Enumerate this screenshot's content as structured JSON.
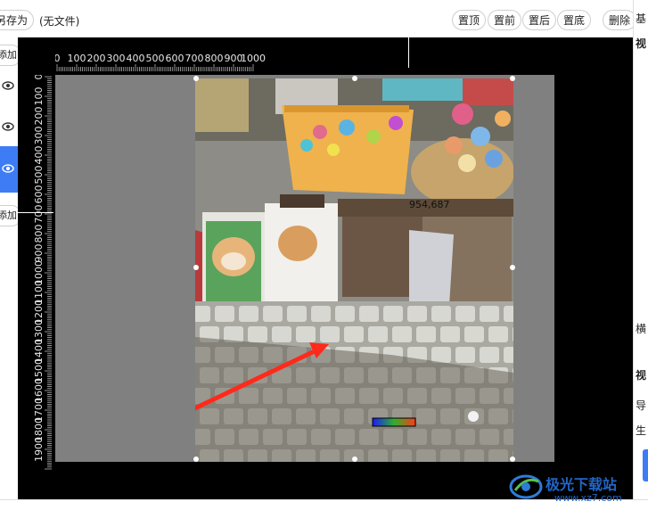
{
  "toolbar": {
    "save_as": "另存为",
    "file_name": "(无文件)",
    "to_top": "置顶",
    "forward": "置前",
    "backward": "置后",
    "to_bottom": "置底",
    "delete": "删除"
  },
  "sidebar": {
    "add_top": "添加",
    "add_bottom": "添加"
  },
  "rulers": {
    "top": [
      "0",
      "100",
      "200",
      "300",
      "400",
      "500",
      "600",
      "700",
      "800",
      "900",
      "1000"
    ],
    "left": [
      "0",
      "100",
      "200",
      "300",
      "400",
      "500",
      "600",
      "700",
      "800",
      "900",
      "1000",
      "1100",
      "1200",
      "1300",
      "1400",
      "1500",
      "1600",
      "1700",
      "1800",
      "1900"
    ]
  },
  "canvas": {
    "cursor_coords": "954,687"
  },
  "right_panel": {
    "header": "基",
    "section1": "视",
    "label1": "横",
    "section2": "视",
    "label2": "导",
    "label3": "生"
  },
  "watermark": {
    "brand": "极光下载站",
    "url": "www.xz7.com"
  }
}
